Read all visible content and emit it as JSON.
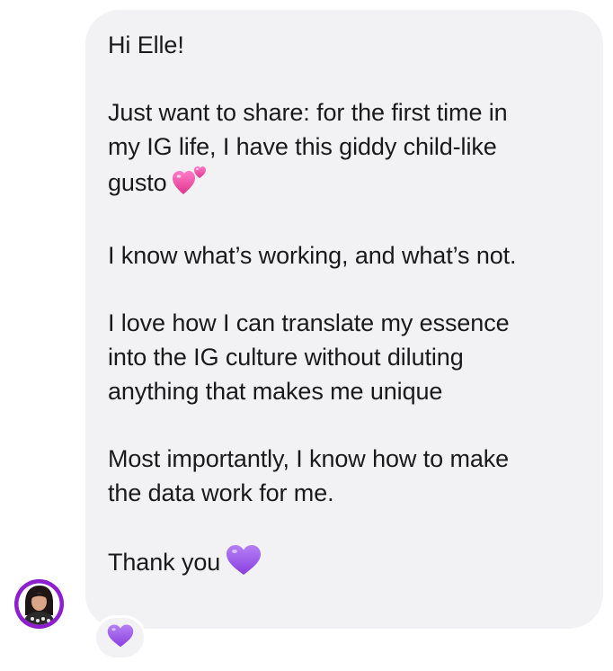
{
  "message": {
    "greeting": "Hi Elle!",
    "paragraph_1": "Just want to share: for the first time in\nmy IG life, I have this giddy child-like\ngusto",
    "paragraph_1_emoji": "two-hearts-icon",
    "paragraph_2": "I know what’s working, and what’s not.",
    "paragraph_3": "I love how I can translate my essence\ninto the IG culture without diluting\nanything that makes me unique",
    "paragraph_4": "Most importantly, I know how to make\nthe data work for me.",
    "closing": "Thank you",
    "closing_emoji": "purple-heart-icon"
  },
  "reaction": {
    "emoji": "purple-heart-icon"
  },
  "colors": {
    "bubble_background": "#f2f2f5",
    "text": "#1a1a1a",
    "avatar_ring": "#8d1fd0",
    "purple_heart": "#9b59e6",
    "pink_heart": "#f05ab0"
  }
}
